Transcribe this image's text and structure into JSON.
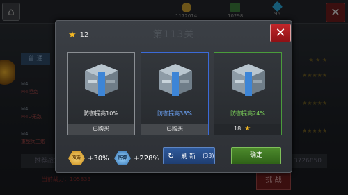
{
  "background": {
    "home_glyph": "⌂",
    "close_glyph": "✕",
    "resources": [
      {
        "icon": "coin-icon",
        "color": "#c79b2f",
        "value": "1172014"
      },
      {
        "icon": "oil-icon",
        "color": "#3b7a3b",
        "value": "10298"
      },
      {
        "icon": "diamond-icon",
        "color": "#2aa7d8",
        "value": "96"
      }
    ],
    "tab_label": "普 通",
    "rows": [
      {
        "name": "M4坦克",
        "top": "M4",
        "name2": "M4D无敌"
      },
      {
        "name": "M4D无敌",
        "top": "M4",
        "name2": "M4D无敌"
      },
      {
        "name": "重型兵主炮",
        "top": "M4",
        "name2": "重型兵主炮"
      }
    ],
    "bottom_text": "推荐战力",
    "bottom_number": "13726850",
    "red_text": "当前战力：105833",
    "fight_label": "挑 战"
  },
  "modal": {
    "title": "第113关",
    "stars": "12",
    "close_label": "✕",
    "cards": [
      {
        "label": "防御提高10%",
        "footer": "已购买",
        "state": "normal"
      },
      {
        "label": "防御提高38%",
        "footer": "已购买",
        "state": "selected"
      },
      {
        "label": "防御提高24%",
        "footer": "18",
        "state": "green"
      }
    ],
    "stats": {
      "attack_badge": "攻击",
      "attack_value": "+30%",
      "defense_badge": "防御",
      "defense_value": "+228%"
    },
    "refresh": {
      "label": "刷 新",
      "count": "(33)"
    },
    "confirm_label": "确定"
  },
  "colors": {
    "accent_blue": "#3b6ad8",
    "accent_green": "#4a9c3b",
    "star": "#f4b823",
    "close_red": "#c2262a"
  }
}
